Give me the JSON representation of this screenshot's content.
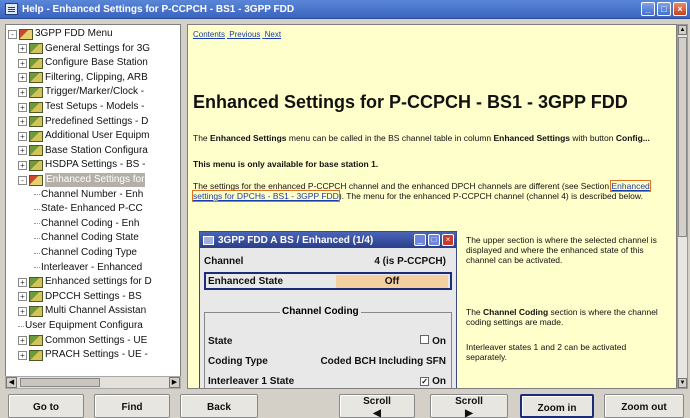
{
  "window": {
    "title": "Help - Enhanced Settings for P-CCPCH - BS1 - 3GPP FDD",
    "buttons": [
      "minimize",
      "maximize",
      "close"
    ]
  },
  "tree": {
    "items": [
      {
        "label": "3GPP FDD Menu",
        "indent": 0,
        "expander": "-",
        "icon": "book-open-icon"
      },
      {
        "label": "General Settings for 3G",
        "indent": 1,
        "expander": "+",
        "icon": "book-icon"
      },
      {
        "label": "Configure Base Station",
        "indent": 1,
        "expander": "+",
        "icon": "book-icon"
      },
      {
        "label": "Filtering, Clipping, ARB",
        "indent": 1,
        "expander": "+",
        "icon": "book-icon"
      },
      {
        "label": "Trigger/Marker/Clock - ",
        "indent": 1,
        "expander": "+",
        "icon": "book-icon"
      },
      {
        "label": "Test Setups - Models - ",
        "indent": 1,
        "expander": "+",
        "icon": "book-icon"
      },
      {
        "label": "Predefined Settings - D",
        "indent": 1,
        "expander": "+",
        "icon": "book-icon"
      },
      {
        "label": "Additional User Equipm",
        "indent": 1,
        "expander": "+",
        "icon": "book-icon"
      },
      {
        "label": "Base Station Configura",
        "indent": 1,
        "expander": "+",
        "icon": "book-icon"
      },
      {
        "label": "HSDPA Settings - BS - ",
        "indent": 1,
        "expander": "+",
        "icon": "book-icon"
      },
      {
        "label": "Enhanced Settings for ",
        "indent": 1,
        "expander": "-",
        "icon": "book-open-icon",
        "selected": true
      },
      {
        "label": "Channel Number - Enh",
        "indent": 2,
        "expander": "",
        "icon": ""
      },
      {
        "label": "State-  Enhanced P-CC",
        "indent": 2,
        "expander": "",
        "icon": ""
      },
      {
        "label": "Channel Coding  - Enh",
        "indent": 2,
        "expander": "",
        "icon": ""
      },
      {
        "label": "Channel Coding State ",
        "indent": 2,
        "expander": "",
        "icon": ""
      },
      {
        "label": "Channel Coding Type ",
        "indent": 2,
        "expander": "",
        "icon": ""
      },
      {
        "label": "Interleaver - Enhanced",
        "indent": 2,
        "expander": "",
        "icon": ""
      },
      {
        "label": "Enhanced settings for D",
        "indent": 1,
        "expander": "+",
        "icon": "book-icon"
      },
      {
        "label": "DPCCH Settings - BS ",
        "indent": 1,
        "expander": "+",
        "icon": "book-icon"
      },
      {
        "label": "Multi Channel Assistan",
        "indent": 1,
        "expander": "+",
        "icon": "book-icon"
      },
      {
        "label": "User Equipment Configura",
        "indent": 1,
        "expander": "",
        "icon": ""
      },
      {
        "label": "Common Settings - UE",
        "indent": 1,
        "expander": "+",
        "icon": "book-icon"
      },
      {
        "label": "PRACH Settings - UE - ",
        "indent": 1,
        "expander": "+",
        "icon": "book-icon"
      }
    ]
  },
  "content": {
    "nav": {
      "contents": "Contents",
      "previous": "Previous",
      "next": "Next"
    },
    "heading": "Enhanced Settings for P-CCPCH - BS1 - 3GPP FDD",
    "para1_a": "The ",
    "para1_b": "Enhanced Settings",
    "para1_c": " menu can be called in the BS channel table in column ",
    "para1_d": "Enhanced Settings",
    "para1_e": " with button ",
    "para1_f": "Config...",
    "para2": "This menu is only available for base station 1.",
    "para3_a": "The settings for the enhanced P-CCPCH channel and the enhanced DPCH channels are different (see Section ",
    "para3_link": "Enhanced settings for DPCHs - BS1 - 3GPP FDD",
    "para3_b": "). The menu for the enhanced P-CCPCH channel (channel 4) is described below.",
    "side1": "The upper section is where the selected channel is displayed and where the enhanced state of this channel can be activated.",
    "side2_a": "The ",
    "side2_b": "Channel Coding",
    "side2_c": " section is where the channel coding settings are made.",
    "side3": "Interleaver states 1 and 2 can be activated separately."
  },
  "dialog": {
    "title": "3GPP FDD A BS / Enhanced (1/4)",
    "channel_label": "Channel",
    "channel_value": "4 (is P-CCPCH)",
    "enhanced_state_label": "Enhanced State",
    "enhanced_state_value": "Off",
    "group_title": "Channel Coding",
    "state_label": "State",
    "state_check": "On",
    "coding_type_label": "Coding Type",
    "coding_type_value": "Coded BCH Including SFN",
    "interleaver_label": "Interleaver 1 State",
    "interleaver_check": "On"
  },
  "toolbar": {
    "goto": "Go to",
    "find": "Find",
    "back": "Back",
    "scroll_left": "Scroll",
    "scroll_right": "Scroll",
    "zoom_in": "Zoom in",
    "zoom_out": "Zoom out"
  }
}
